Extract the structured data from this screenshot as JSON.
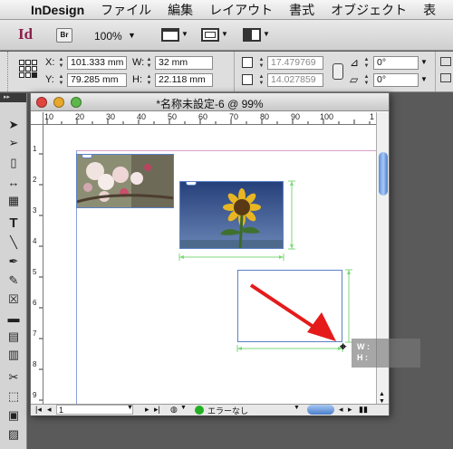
{
  "menubar": {
    "apple": "",
    "app": "InDesign",
    "items": [
      "ファイル",
      "編集",
      "レイアウト",
      "書式",
      "オブジェクト",
      "表"
    ]
  },
  "appbar": {
    "logo": "Id",
    "bridge": "Br",
    "zoom": "100%"
  },
  "control": {
    "x_label": "X:",
    "y_label": "Y:",
    "w_label": "W:",
    "h_label": "H:",
    "x_value": "101.333 mm",
    "y_value": "79.285 mm",
    "w_value": "32 mm",
    "h_value": "22.118 mm",
    "scale_x": "17.479769",
    "scale_y": "14.027859",
    "angle": "0°",
    "shear": "0°"
  },
  "document": {
    "title": "*名称未設定-6 @ 99%",
    "ruler_h": [
      "10",
      "20",
      "30",
      "40",
      "50",
      "60",
      "70",
      "80",
      "90",
      "100",
      "1"
    ],
    "ruler_v": [
      "1",
      "2",
      "3",
      "4",
      "5",
      "6",
      "7",
      "8",
      "9"
    ],
    "page": "1",
    "preflight": "エラーなし"
  },
  "measure_hint": {
    "w_label": "W :",
    "h_label": "H :"
  },
  "colors": {
    "selection": "#5b80c8",
    "guide": "#7dd87a",
    "arrow": "#e51b1b",
    "ok": "#22b022"
  }
}
